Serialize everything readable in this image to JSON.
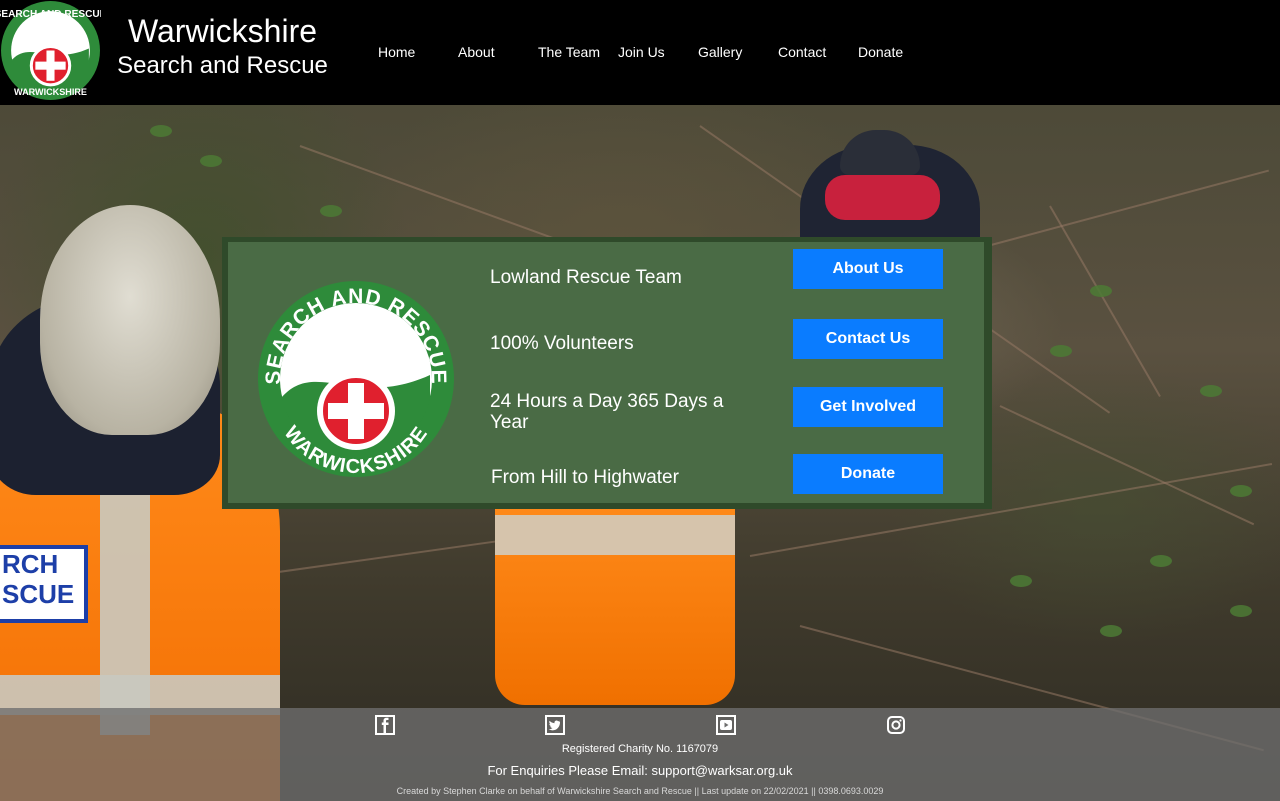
{
  "header": {
    "title_line1": "Warwickshire",
    "title_line2": "Search and Rescue",
    "logo_icon": "warwickshire-search-and-rescue-logo",
    "nav": [
      {
        "label": "Home"
      },
      {
        "label": "About"
      },
      {
        "label": "The Team"
      },
      {
        "label": "Join Us"
      },
      {
        "label": "Gallery"
      },
      {
        "label": "Contact"
      },
      {
        "label": "Donate"
      }
    ]
  },
  "panel": {
    "logo_text_top": "SEARCH AND RESCUE",
    "logo_text_bottom": "WARWICKSHIRE",
    "features": [
      "Lowland Rescue Team",
      "100% Volunteers",
      "24 Hours a Day 365 Days a Year",
      "From Hill to Highwater"
    ],
    "buttons": [
      {
        "label": "About Us"
      },
      {
        "label": "Contact Us"
      },
      {
        "label": "Get Involved"
      },
      {
        "label": "Donate"
      }
    ]
  },
  "footer": {
    "social_icons": [
      "facebook-icon",
      "twitter-icon",
      "youtube-icon",
      "instagram-icon"
    ],
    "charity": "Registered Charity No. 1167079",
    "enquiry": "For Enquiries Please Email: support@warksar.org.uk",
    "credit": "Created by Stephen Clarke on behalf of Warwickshire Search and Rescue || Last update on 22/02/2021 || 0398.0693.0029"
  },
  "colors": {
    "header_bg": "#000000",
    "panel_bg": "#4a6b45",
    "panel_border": "#2f4a2a",
    "button_bg": "#0a7cff",
    "logo_green": "#2e8b3a",
    "logo_red": "#e0202e"
  }
}
